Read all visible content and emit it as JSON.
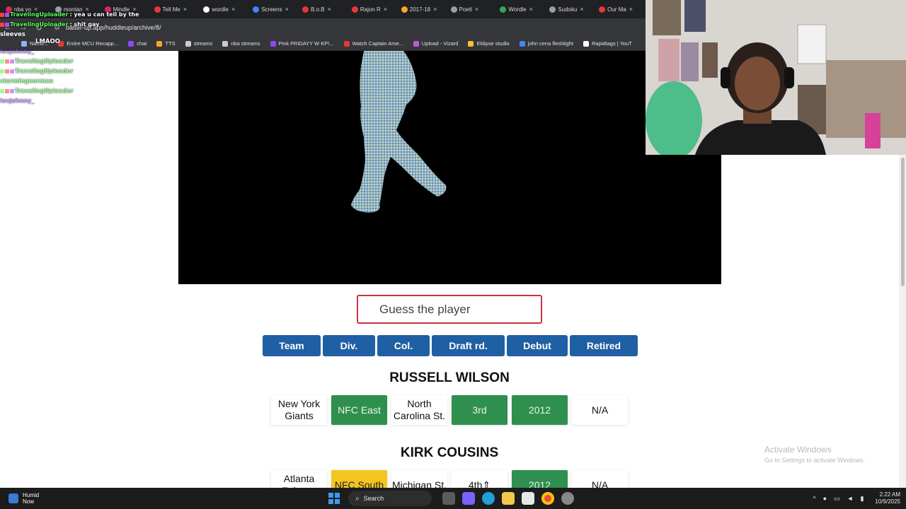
{
  "browser": {
    "tabs": [
      {
        "label": "nba yo",
        "color": "#e0245e"
      },
      {
        "label": "montan",
        "color": "#9aa0a6"
      },
      {
        "label": "Mindle",
        "color": "#e0245e"
      },
      {
        "label": "Tell Me",
        "color": "#e53935"
      },
      {
        "label": "wordle",
        "color": "#ffffff"
      },
      {
        "label": "Screens",
        "color": "#4285f4"
      },
      {
        "label": "B.o.B",
        "color": "#e53935"
      },
      {
        "label": "Rajon R",
        "color": "#e53935"
      },
      {
        "label": "2017-18",
        "color": "#f9a825"
      },
      {
        "label": "Poetl",
        "color": "#9aa0a6"
      },
      {
        "label": "Wordle",
        "color": "#34a853"
      },
      {
        "label": "Sudoku",
        "color": "#9aa0a6"
      },
      {
        "label": "Our Ma",
        "color": "#e53935"
      }
    ],
    "url": "batter-up.app/huddleup/archive/8/",
    "bookmarks": [
      {
        "label": "Name...",
        "color": "#8ab4f8"
      },
      {
        "label": "Entire MCU Recapp...",
        "color": "#e53935"
      },
      {
        "label": "chat",
        "color": "#9146ff"
      },
      {
        "label": "TTS",
        "color": "#f9a825"
      },
      {
        "label": "streams",
        "color": "#cccccc"
      },
      {
        "label": "nba streams",
        "color": "#cccccc"
      },
      {
        "label": "Pink FRIDAYY W KP!...",
        "color": "#9146ff"
      },
      {
        "label": "Watch Captain Ame...",
        "color": "#e53935"
      },
      {
        "label": "Upload - Vizard",
        "color": "#c158dc"
      },
      {
        "label": "Eklipse studio",
        "color": "#fbc02d"
      },
      {
        "label": "john cena fleshlight",
        "color": "#4285f4"
      },
      {
        "label": "Rapidtags | YouT",
        "color": "#ffffff"
      }
    ]
  },
  "chat": {
    "top_lines": [
      {
        "user": "TravelingUploader",
        "message": ": yea u can tell by the",
        "color": "#5cff5c"
      },
      {
        "user": "TravelingUploader",
        "message": ": shit gay",
        "color": "#5cff5c"
      }
    ],
    "continuation": "sleeves",
    "lmao": "LMAOO",
    "faded_lines": [
      {
        "user": "luvjohnny_",
        "message": "",
        "color": "#9b59ff"
      },
      {
        "user": "TravelingUploader",
        "message": "",
        "color": "#5cff5c"
      },
      {
        "user": "TravelingUploader",
        "message": "",
        "color": "#5cff5c"
      },
      {
        "user": "stormingnorman",
        "message": "",
        "color": "#5cff5c"
      },
      {
        "user": "TravelingUploader",
        "message": "",
        "color": "#5cff5c"
      },
      {
        "user": "luvjohnny_",
        "message": "",
        "color": "#9b59ff"
      }
    ]
  },
  "game": {
    "guess_placeholder": "Guess the player",
    "categories": [
      {
        "label": "Team"
      },
      {
        "label": "Div."
      },
      {
        "label": "Col."
      },
      {
        "label": "Draft rd."
      },
      {
        "label": "Debut"
      },
      {
        "label": "Retired"
      }
    ],
    "guesses": [
      {
        "name": "RUSSELL WILSON",
        "cells": [
          {
            "text": "New York Giants",
            "status": "none"
          },
          {
            "text": "NFC East",
            "status": "green"
          },
          {
            "text": "North Carolina St.",
            "status": "none"
          },
          {
            "text": "3rd",
            "status": "green"
          },
          {
            "text": "2012",
            "status": "green"
          },
          {
            "text": "N/A",
            "status": "none"
          }
        ]
      },
      {
        "name": "KIRK COUSINS",
        "cells": [
          {
            "text": "Atlanta Falcons",
            "status": "none"
          },
          {
            "text": "NFC South",
            "status": "yellow"
          },
          {
            "text": "Michigan St.",
            "status": "none"
          },
          {
            "text": "4th",
            "status": "none",
            "arrow": "up"
          },
          {
            "text": "2012",
            "status": "green"
          },
          {
            "text": "N/A",
            "status": "none"
          }
        ]
      }
    ]
  },
  "watermark": {
    "title": "Activate Windows",
    "subtitle": "Go to Settings to activate Windows."
  },
  "taskbar": {
    "weather_title": "Humid",
    "weather_sub": "Now",
    "search_label": "Search",
    "time": "2:22 AM",
    "date": "10/9/2025"
  }
}
